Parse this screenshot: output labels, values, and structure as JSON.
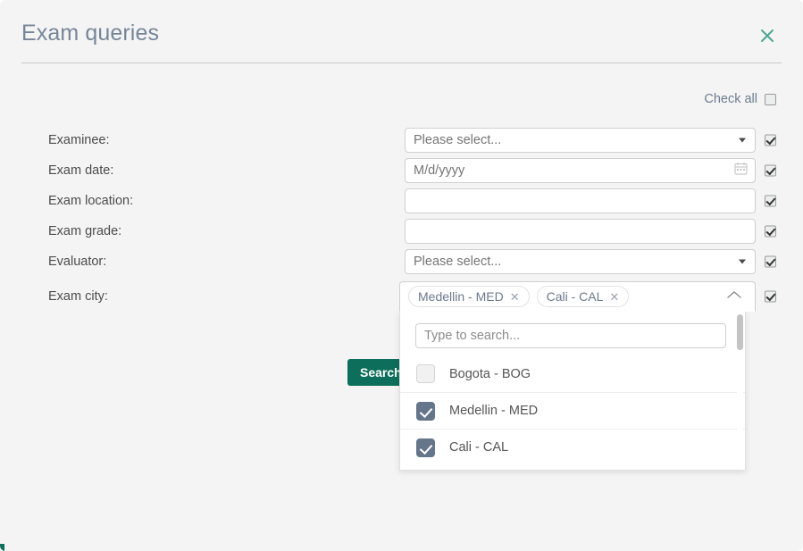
{
  "dialog": {
    "title": "Exam queries",
    "close_icon": "close-icon"
  },
  "check_all": {
    "label": "Check all",
    "checked": false
  },
  "form": {
    "rows": [
      {
        "label": "Examinee:",
        "control": "select",
        "value": "Please select...",
        "icon": "chevron-down-icon",
        "checked": true
      },
      {
        "label": "Exam date:",
        "control": "date",
        "value": "M/d/yyyy",
        "icon": "calendar-icon",
        "checked": true
      },
      {
        "label": "Exam location:",
        "control": "text",
        "value": "",
        "icon": "",
        "checked": true
      },
      {
        "label": "Exam grade:",
        "control": "text",
        "value": "",
        "icon": "",
        "checked": true
      },
      {
        "label": "Evaluator:",
        "control": "select",
        "value": "Please select...",
        "icon": "chevron-down-icon",
        "checked": true
      },
      {
        "label": "Exam city:",
        "control": "multiselect",
        "value": "",
        "icon": "chevron-up-icon",
        "checked": true
      }
    ]
  },
  "multiselect": {
    "tags": [
      {
        "label": "Medellin - MED",
        "remove_icon": "close-icon"
      },
      {
        "label": "Cali - CAL",
        "remove_icon": "close-icon"
      }
    ],
    "expanded": true,
    "toggle_icon": "chevron-up-icon",
    "search_placeholder": "Type to search...",
    "search_value": "",
    "options": [
      {
        "label": "Bogota - BOG",
        "checked": false
      },
      {
        "label": "Medellin - MED",
        "checked": true
      },
      {
        "label": "Cali - CAL",
        "checked": true
      }
    ]
  },
  "actions": {
    "search_label": "Search"
  },
  "colors": {
    "accent": "#0d6e5b",
    "title": "#768699",
    "checkbox_checked": "#65758a",
    "page_background": "#f4f4f5",
    "panel_background": "#ffffff"
  }
}
